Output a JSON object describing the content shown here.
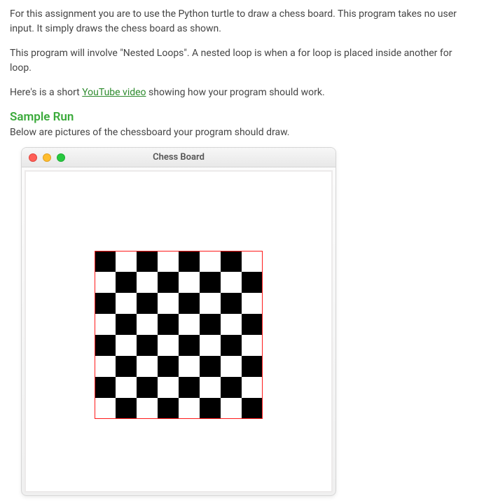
{
  "paragraphs": {
    "p1": "For this assignment you are to use the Python turtle to draw a chess board. This program takes no user input. It simply draws the chess board as shown.",
    "p2a": "This program will involve \"Nested Loops\". A nested loop is when a for loop is placed inside another for loop.",
    "p3a": "Here's is a short ",
    "p3_link": "YouTube video",
    "p3b": " showing how your program should work."
  },
  "heading": "Sample Run",
  "subtext": "Below are pictures of the chessboard your program should draw.",
  "window": {
    "title": "Chess Board"
  },
  "chart_data": {
    "type": "heatmap",
    "title": "Chess Board",
    "rows": 8,
    "cols": 8,
    "border_color": "#ff1a1a",
    "colors": {
      "0": "#ffffff",
      "1": "#000000"
    },
    "grid": [
      [
        1,
        0,
        1,
        0,
        1,
        0,
        1,
        0
      ],
      [
        0,
        1,
        0,
        1,
        0,
        1,
        0,
        1
      ],
      [
        1,
        0,
        1,
        0,
        1,
        0,
        1,
        0
      ],
      [
        0,
        1,
        0,
        1,
        0,
        1,
        0,
        1
      ],
      [
        1,
        0,
        1,
        0,
        1,
        0,
        1,
        0
      ],
      [
        0,
        1,
        0,
        1,
        0,
        1,
        0,
        1
      ],
      [
        1,
        0,
        1,
        0,
        1,
        0,
        1,
        0
      ],
      [
        0,
        1,
        0,
        1,
        0,
        1,
        0,
        1
      ]
    ]
  }
}
